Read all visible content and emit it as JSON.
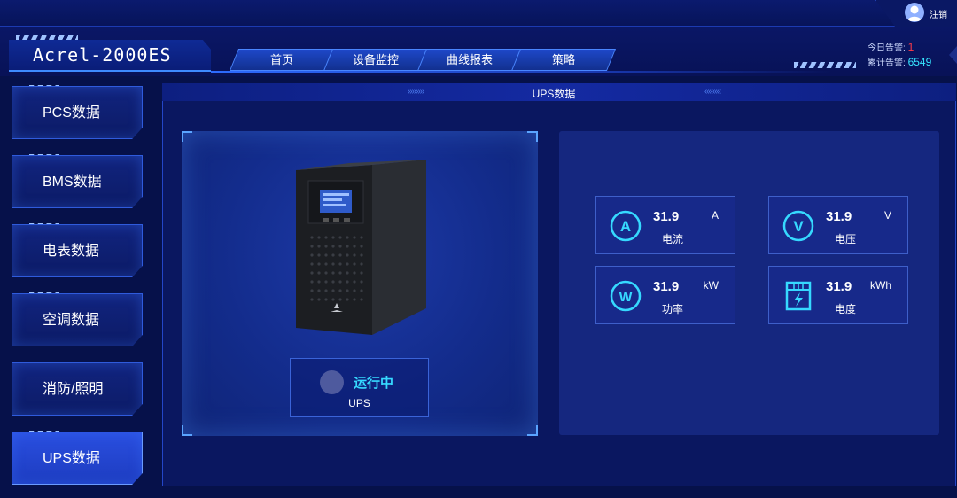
{
  "user": {
    "logout_label": "注销"
  },
  "app": {
    "title": "Acrel-2000ES"
  },
  "nav": {
    "tabs": [
      {
        "label": "首页"
      },
      {
        "label": "设备监控"
      },
      {
        "label": "曲线报表"
      },
      {
        "label": "策略"
      }
    ]
  },
  "alarms": {
    "today_label": "今日告警:",
    "today_value": "1",
    "total_label": "累计告警:",
    "total_value": "6549"
  },
  "sidebar": {
    "items": [
      {
        "label": "PCS数据"
      },
      {
        "label": "BMS数据"
      },
      {
        "label": "电表数据"
      },
      {
        "label": "空调数据"
      },
      {
        "label": "消防/照明"
      },
      {
        "label": "UPS数据",
        "active": true
      }
    ]
  },
  "main": {
    "title": "UPS数据",
    "device": {
      "status": "运行中",
      "name": "UPS"
    },
    "metrics": [
      {
        "icon": "ammeter-A-icon",
        "value": "31.9",
        "unit": "A",
        "label": "电流"
      },
      {
        "icon": "voltmeter-V-icon",
        "value": "31.9",
        "unit": "V",
        "label": "电压"
      },
      {
        "icon": "wattmeter-W-icon",
        "value": "31.9",
        "unit": "kW",
        "label": "功率"
      },
      {
        "icon": "energy-meter-icon",
        "value": "31.9",
        "unit": "kWh",
        "label": "电度"
      }
    ]
  },
  "colors": {
    "background": "#06114a",
    "accent_cyan": "#36d9ff",
    "alarm_red": "#ff3b48",
    "panel_blue": "#15277f",
    "active_tab": "#2a4fe0"
  }
}
